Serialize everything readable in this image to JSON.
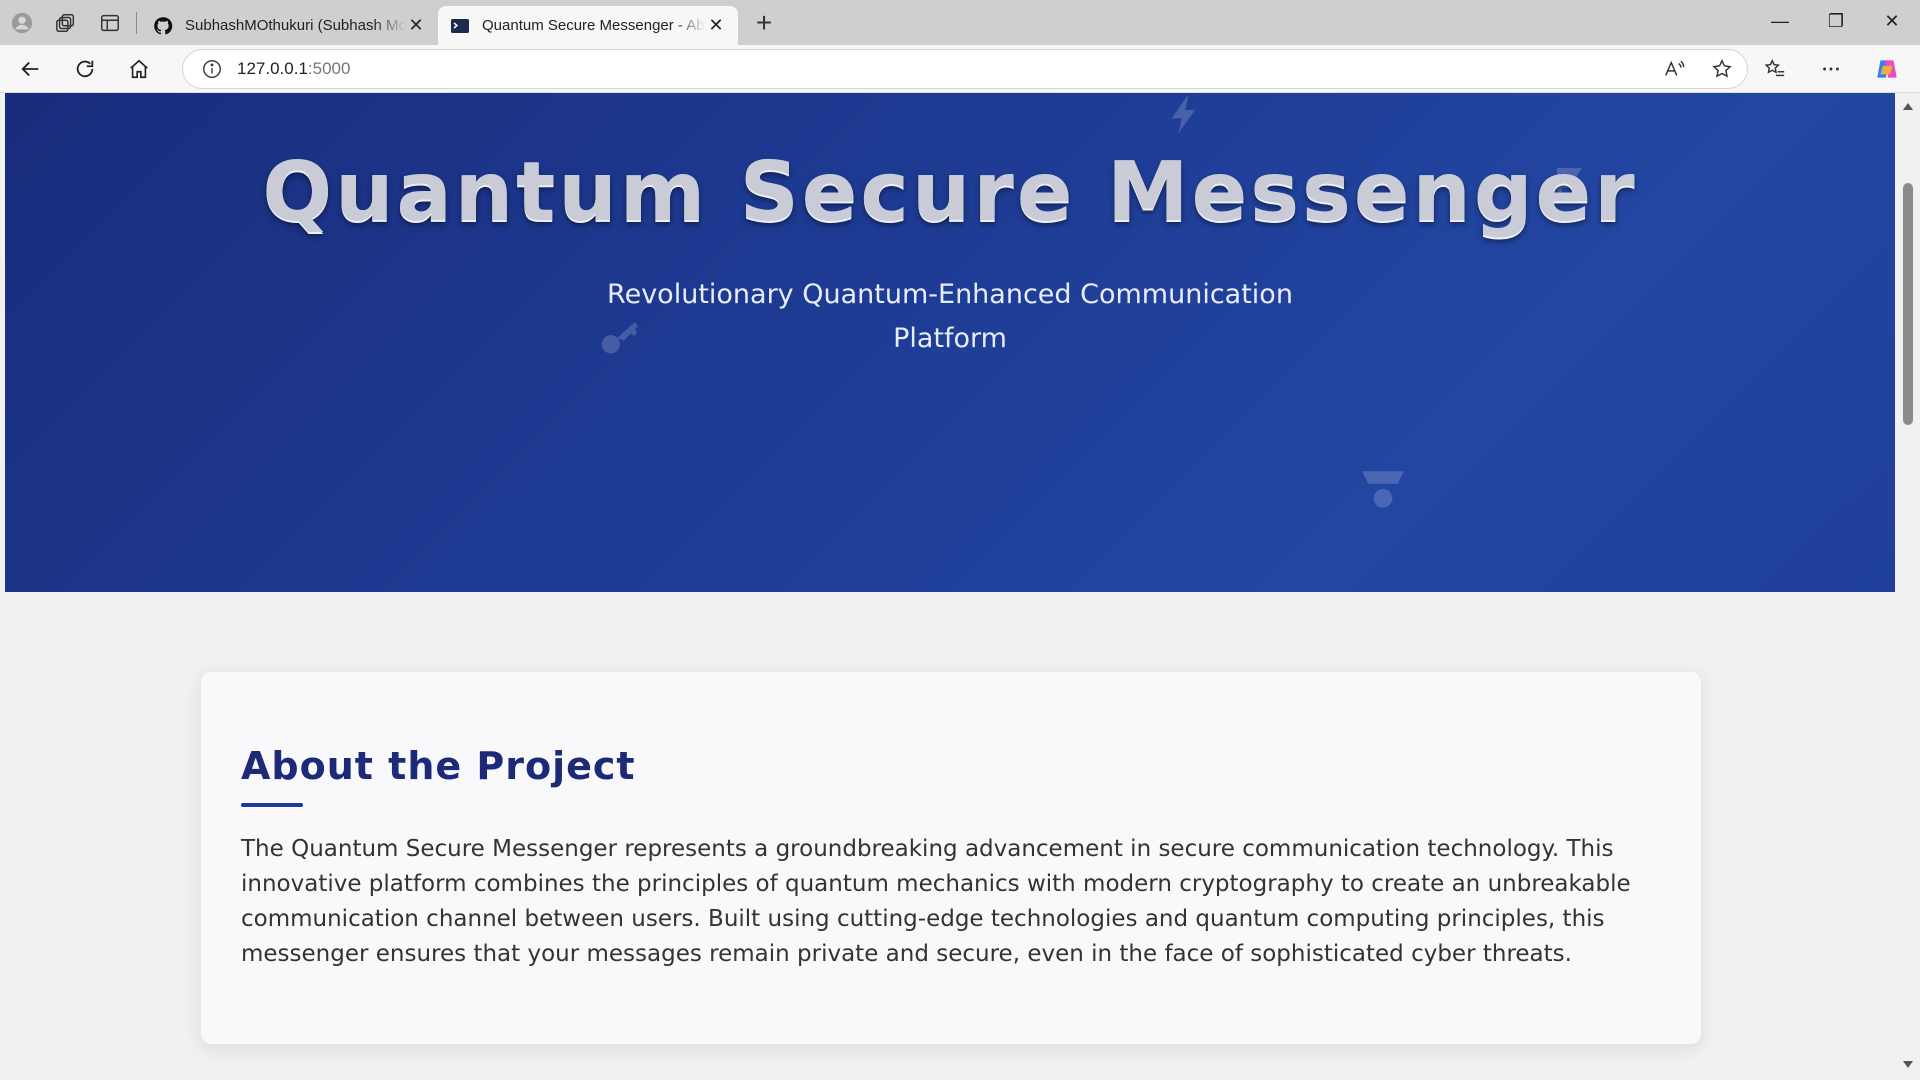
{
  "browser": {
    "tabs": [
      {
        "title": "SubhashMOthukuri (Subhash Mothukuri)",
        "icon": "github-icon"
      },
      {
        "title": "Quantum Secure Messenger - About",
        "icon": "terminal-icon"
      }
    ],
    "url_host": "127.0.0.1",
    "url_port": ":5000"
  },
  "hero": {
    "title": "Quantum Secure Messenger",
    "subtitle_line1": "Revolutionary Quantum-Enhanced Communication",
    "subtitle_line2": "Platform"
  },
  "about": {
    "heading": "About the Project",
    "body": "The Quantum Secure Messenger represents a groundbreaking advancement in secure communication technology. This innovative platform combines the principles of quantum mechanics with modern cryptography to create an unbreakable communication channel between users. Built using cutting-edge technologies and quantum computing principles, this messenger ensures that your messages remain private and secure, even in the face of sophisticated cyber threats."
  },
  "colors": {
    "hero_start": "#1a2c7c",
    "hero_end": "#2346a2",
    "heading": "#1c2a78"
  }
}
